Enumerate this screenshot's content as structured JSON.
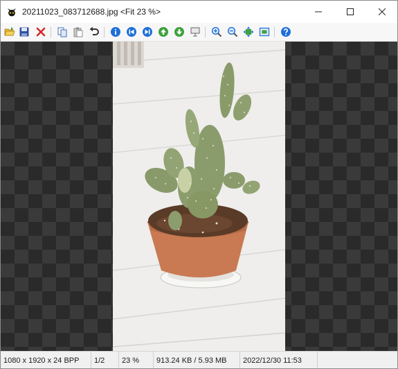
{
  "window": {
    "title": "20211023_083712688.jpg <Fit 23 %>",
    "app_icon": "irfanview-cat-icon",
    "controls": [
      "minimize-icon",
      "maximize-icon",
      "close-icon"
    ]
  },
  "toolbar": {
    "buttons": [
      "open-folder-icon",
      "save-icon",
      "delete-icon",
      "copy-icon",
      "paste-icon",
      "undo-icon",
      "info-icon",
      "previous-file-icon",
      "next-file-icon",
      "move-up-icon",
      "move-down-icon",
      "slideshow-icon",
      "zoom-in-icon",
      "zoom-out-icon",
      "fit-window-icon",
      "fullscreen-icon",
      "help-icon"
    ],
    "accent_blue": "#1e6fd9",
    "accent_green": "#3ca23c",
    "accent_red": "#d22a2a"
  },
  "viewer": {
    "image_subject": "potted-bunny-ear-cactus-photo",
    "background": "checkerboard"
  },
  "status": {
    "dimensions": "1080 x 1920 x 24 BPP",
    "index": "1/2",
    "zoom": "23 %",
    "filesize": "913.24 KB / 5.93 MB",
    "datetime": "2022/12/30 11:53"
  }
}
